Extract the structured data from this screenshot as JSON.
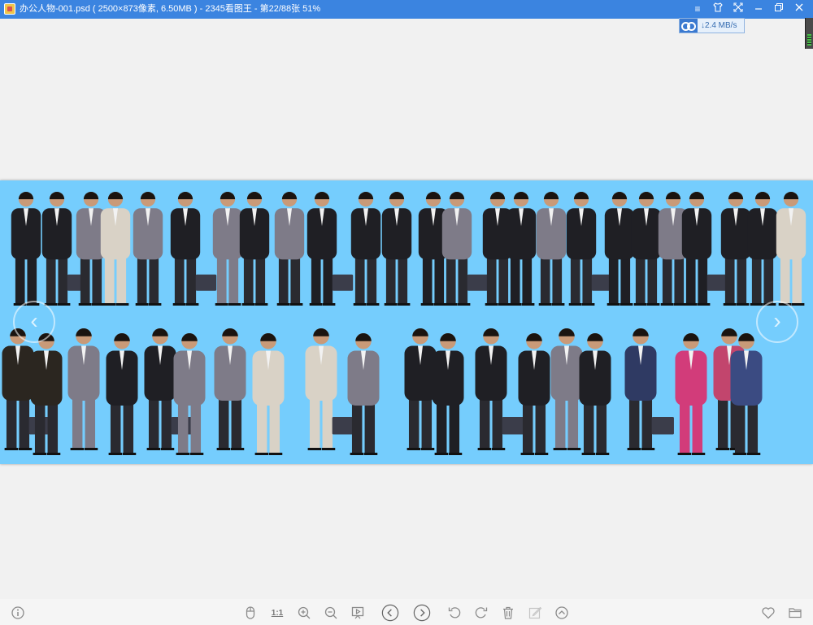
{
  "window": {
    "title": "办公人物-001.psd ( 2500×873像素, 6.50MB ) - 2345看图王 - 第22/88张 51%",
    "icon": "app-logo-icon",
    "controls": [
      "menu-icon",
      "skin-icon",
      "fullscreen-icon",
      "minimize-icon",
      "restore-icon",
      "close-icon"
    ]
  },
  "speed_widget": {
    "text": "2.4 MB/s",
    "arrow": "↓"
  },
  "image": {
    "background": "#75cdfd",
    "alt": "办公人物"
  },
  "nav": {
    "prev_glyph": "‹",
    "next_glyph": "›"
  },
  "toolbar": {
    "info": "info-icon",
    "actual_size_label": "1:1",
    "left_group": [
      "mouse-icon",
      "actual-size",
      "zoom-in-icon",
      "zoom-out-icon",
      "slideshow-icon"
    ],
    "center_group": [
      "previous-icon",
      "next-icon"
    ],
    "right_group": [
      "rotate-left-icon",
      "rotate-right-icon",
      "delete-icon",
      "edit-icon",
      "more-icon"
    ],
    "end_group": [
      "favorite-icon",
      "folder-icon"
    ]
  },
  "colors": {
    "titlebar": "#3b84e0",
    "canvas": "#f1f1f1",
    "image_bg": "#75cdfd",
    "toolbar_icon": "#8a8a8a"
  }
}
